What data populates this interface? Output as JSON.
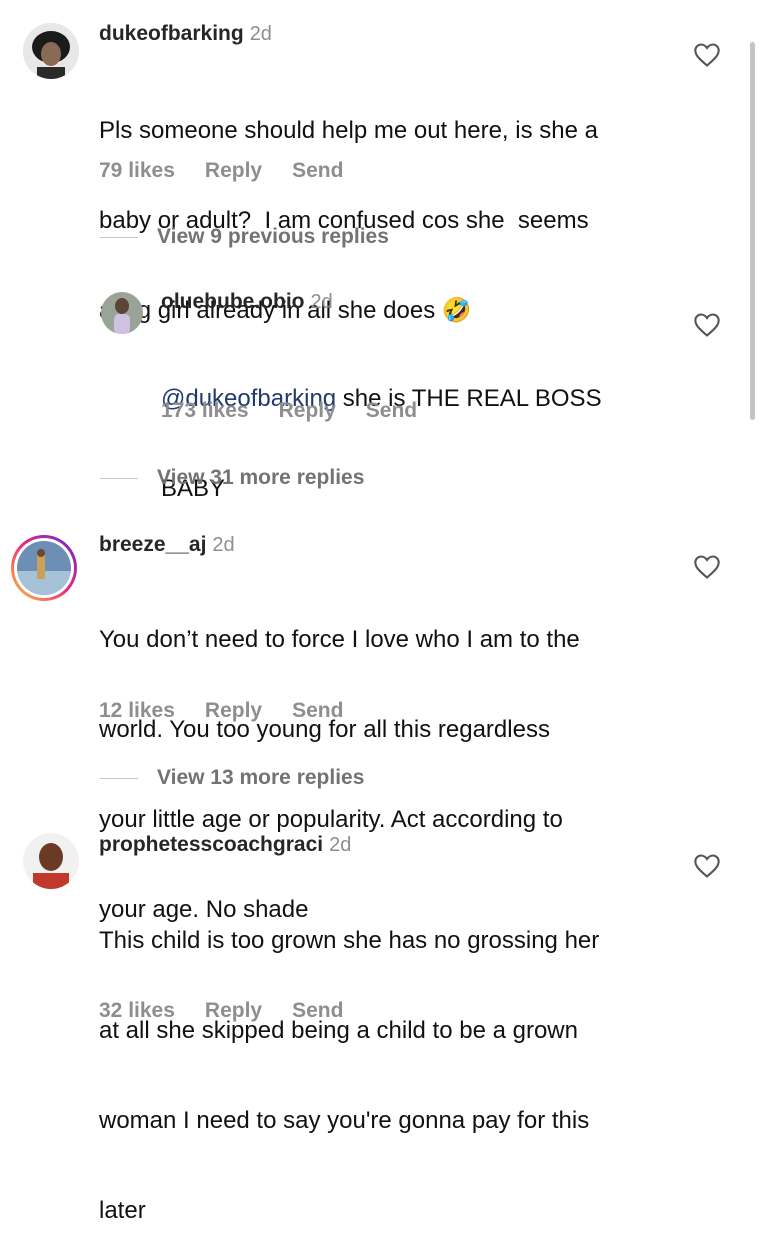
{
  "comments": [
    {
      "username": "dukeofbarking",
      "age": "2d",
      "lines": [
        "Pls someone should help me out here, is she a",
        "baby or adult?  I am confused cos she  seems",
        "a big girl already in all she does"
      ],
      "emoji": "🤣",
      "likes": "79 likes",
      "reply_label": "Reply",
      "send_label": "Send"
    },
    {
      "username": "oluebube.obio",
      "age": "2d",
      "mention": "@dukeofbarking",
      "lines": [
        " she is THE REAL BOSS",
        "BABY"
      ],
      "likes": "173 likes",
      "reply_label": "Reply",
      "send_label": "Send"
    },
    {
      "username": "breeze__aj",
      "age": "2d",
      "lines": [
        "You don’t need to force I love who I am to the",
        "world. You too young for all this regardless",
        "your little age or popularity. Act according to",
        "your age. No shade"
      ],
      "likes": "12 likes",
      "reply_label": "Reply",
      "send_label": "Send"
    },
    {
      "username": "prophetesscoachgraci",
      "age": "2d",
      "lines": [
        "This child is too grown she has no grossing her",
        "at all she skipped being a child to be a grown",
        "woman I need to say you're gonna pay for this",
        "later"
      ],
      "likes": "32 likes",
      "reply_label": "Reply",
      "send_label": "Send"
    }
  ],
  "view_replies": {
    "previous_9": "View 9 previous replies",
    "more_31": "View 31 more replies",
    "more_13": "View 13 more replies"
  },
  "icons": {
    "like": "heart-outline-icon"
  },
  "colors": {
    "text": "#111111",
    "muted": "#8e8e8e",
    "mention": "#1f3a6e",
    "story_ring": "#d6249f"
  }
}
